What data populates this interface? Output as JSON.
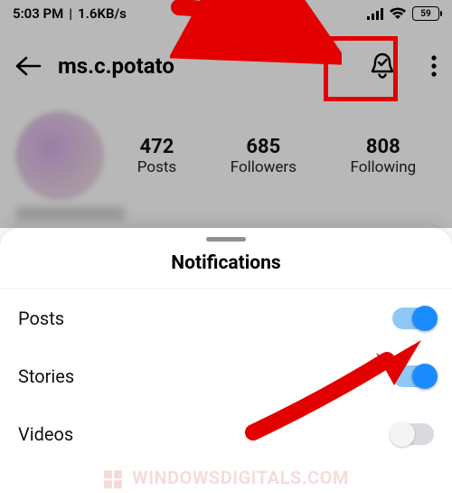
{
  "status_bar": {
    "time": "5:03 PM",
    "net_speed": "1.6KB/s",
    "battery_pct": "59"
  },
  "profile": {
    "username": "ms.c.potato",
    "stats": {
      "posts_count": "472",
      "posts_label": "Posts",
      "followers_count": "685",
      "followers_label": "Followers",
      "following_count": "808",
      "following_label": "Following"
    }
  },
  "sheet": {
    "title": "Notifications",
    "rows": [
      {
        "label": "Posts",
        "on": true
      },
      {
        "label": "Stories",
        "on": true
      },
      {
        "label": "Videos",
        "on": false
      }
    ]
  },
  "watermark": "WindowsDigitals.com",
  "annotation": {
    "highlight_color": "#e20000"
  }
}
